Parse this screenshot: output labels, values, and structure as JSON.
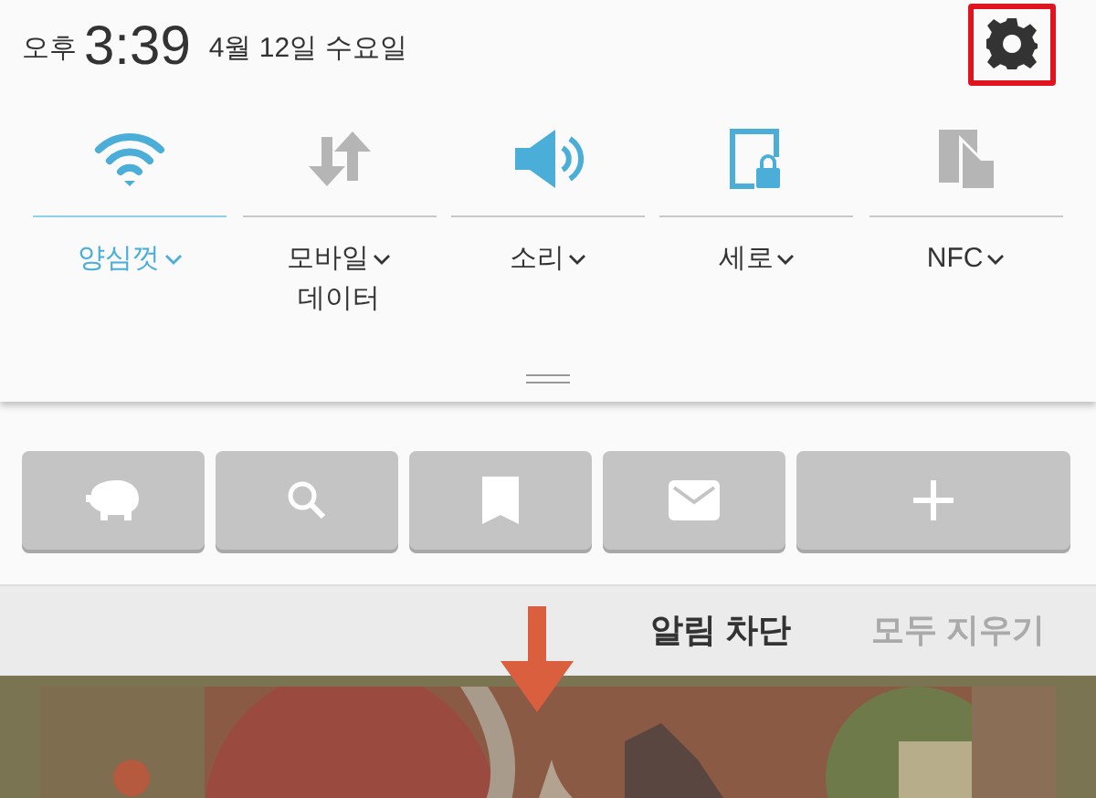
{
  "status": {
    "ampm": "오후",
    "time": "3:39",
    "date": "4월 12일 수요일"
  },
  "quick_toggles": [
    {
      "kind": "wifi",
      "label": "양심껏",
      "on": true,
      "selected": true
    },
    {
      "kind": "mobile-data",
      "label": "모바일",
      "label_line2": "데이터",
      "on": false,
      "selected": false
    },
    {
      "kind": "sound",
      "label": "소리",
      "on": true,
      "selected": false
    },
    {
      "kind": "rotation",
      "label": "세로",
      "on": true,
      "selected": false
    },
    {
      "kind": "nfc",
      "label": "NFC",
      "on": false,
      "selected": false
    }
  ],
  "shortcuts": [
    {
      "kind": "piggy"
    },
    {
      "kind": "search"
    },
    {
      "kind": "bookmark"
    },
    {
      "kind": "mail"
    },
    {
      "kind": "add"
    }
  ],
  "notification_bar": {
    "block": "알림 차단",
    "clear_all": "모두 지우기"
  }
}
